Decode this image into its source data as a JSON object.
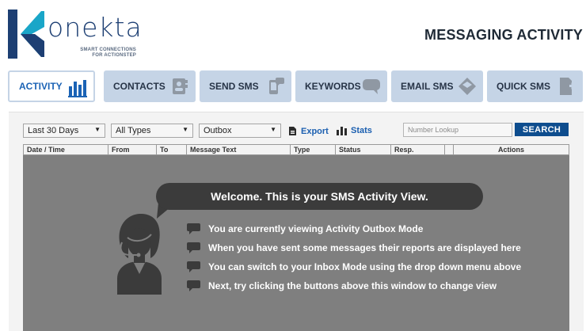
{
  "logo": {
    "wordmark": "onekta",
    "tagline_line1": "SMART CONNECTIONS",
    "tagline_line2": "FOR ACTIONSTEP"
  },
  "header": {
    "title": "MESSAGING ACTIVITY"
  },
  "tabs": [
    {
      "label": "ACTIVITY",
      "icon": "bar-chart-icon",
      "active": true
    },
    {
      "label": "CONTACTS",
      "icon": "address-book-icon",
      "active": false
    },
    {
      "label": "SEND SMS",
      "icon": "mobile-message-icon",
      "active": false
    },
    {
      "label": "KEYWORDS",
      "icon": "speech-bubble-icon",
      "active": false
    },
    {
      "label": "EMAIL SMS",
      "icon": "envelope-icon",
      "active": false
    },
    {
      "label": "QUICK SMS",
      "icon": "add-contact-icon",
      "active": false
    }
  ],
  "filters": {
    "range": "Last 30 Days",
    "type": "All Types",
    "mode": "Outbox"
  },
  "tools": {
    "export_label": "Export",
    "stats_label": "Stats",
    "lookup_placeholder": "Number Lookup",
    "lookup_value": "",
    "search_label": "SEARCH"
  },
  "table": {
    "columns": [
      "Date / Time",
      "From",
      "To",
      "Message Text",
      "Type",
      "Status",
      "Resp.",
      "",
      "Actions"
    ]
  },
  "welcome": {
    "heading": "Welcome. This is your SMS Activity View.",
    "messages": [
      "You are currently viewing Activity Outbox Mode",
      "When you have sent some messages their reports are displayed here",
      "You can switch to your Inbox Mode using the drop down menu above",
      "Next, try clicking the buttons above this window to change view"
    ]
  },
  "colors": {
    "brand_navy": "#1d3f73",
    "brand_blue": "#1b63b5",
    "tab_bg": "#c5d4e6",
    "search_button": "#0e4d8e",
    "view_bg": "#7f7f7f"
  }
}
